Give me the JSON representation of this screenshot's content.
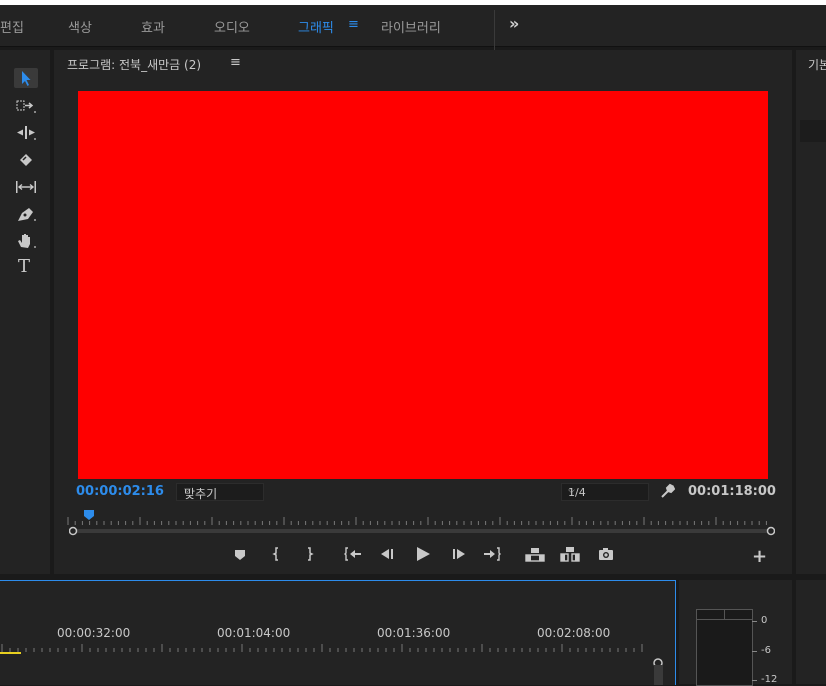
{
  "tabs": [
    {
      "label": "편집",
      "active": false
    },
    {
      "label": "색상",
      "active": false
    },
    {
      "label": "효과",
      "active": false
    },
    {
      "label": "오디오",
      "active": false
    },
    {
      "label": "그래픽",
      "active": true
    },
    {
      "label": "라이브러리",
      "active": false
    }
  ],
  "tab_menu_glyph": "≡",
  "overflow_glyph": "»",
  "tools": [
    {
      "name": "selection-tool",
      "icon": "arrow-icon",
      "selected": true
    },
    {
      "name": "track-select-tool",
      "icon": "track-select-icon",
      "selected": false
    },
    {
      "name": "ripple-edit-tool",
      "icon": "ripple-edit-icon",
      "selected": false
    },
    {
      "name": "razor-tool",
      "icon": "razor-icon",
      "selected": false
    },
    {
      "name": "slip-tool",
      "icon": "slip-icon",
      "selected": false
    },
    {
      "name": "pen-tool",
      "icon": "pen-icon",
      "selected": false
    },
    {
      "name": "hand-tool",
      "icon": "hand-icon",
      "selected": false
    },
    {
      "name": "type-tool",
      "icon": "type-icon",
      "selected": false
    }
  ],
  "type_tool_glyph": "T",
  "monitor": {
    "title": "프로그램: 전북_새만금 (2)",
    "menu_glyph": "≡",
    "video_color": "#ff0000",
    "playhead_timecode": "00:00:02:16",
    "fit_label": "맞추기",
    "resolution_label": "1/4",
    "duration_timecode": "00:01:18:00",
    "dropdown_glyph": "⌵",
    "add_glyph": "+"
  },
  "transport_buttons": [
    "add-marker-button",
    "mark-in-button",
    "mark-out-button",
    "go-to-in-button",
    "step-back-button",
    "play-button",
    "step-forward-button",
    "go-to-out-button",
    "lift-button",
    "extract-button",
    "export-frame-button"
  ],
  "right_panel": {
    "title": "기본"
  },
  "timeline": {
    "timecodes": [
      "00:00:32:00",
      "00:01:04:00",
      "00:01:36:00",
      "00:02:08:00"
    ]
  },
  "audio_meter": {
    "scale": [
      "0",
      "-6",
      "-12"
    ]
  },
  "colors": {
    "accent": "#2d8ceb",
    "panel": "#232323",
    "text": "#c8c8c8",
    "yellow": "#e8d020"
  }
}
